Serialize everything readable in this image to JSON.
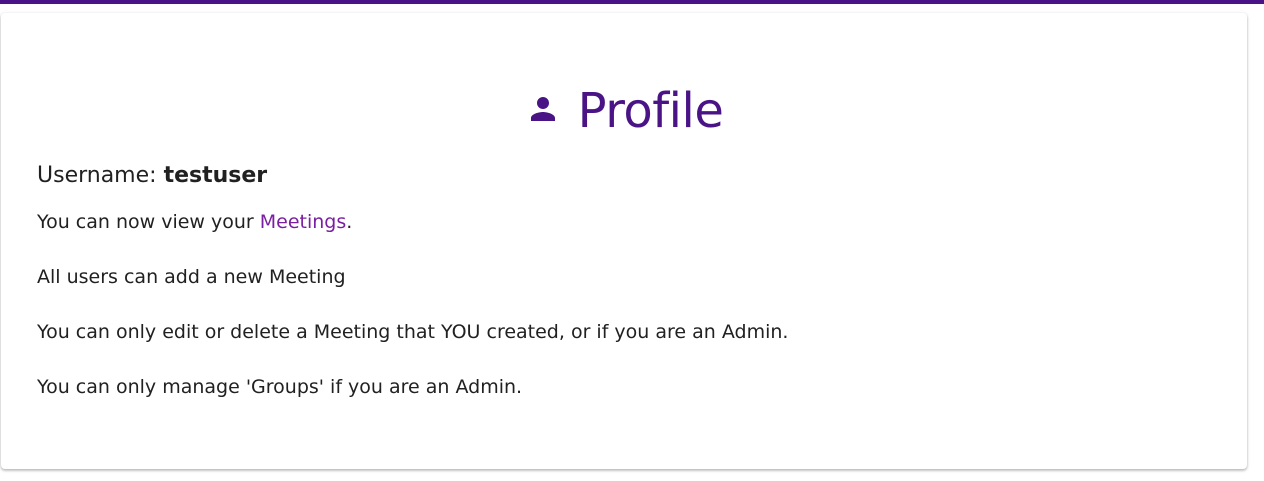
{
  "header": {
    "accent_color": "#4a1486"
  },
  "profile": {
    "icon": "person-icon",
    "title": "Profile",
    "username_label": "Username:",
    "username_value": "testuser",
    "view_prefix": "You can now view your ",
    "meetings_link": "Meetings",
    "view_suffix": ".",
    "info_add": "All users can add a new Meeting",
    "info_edit": "You can only edit or delete a Meeting that YOU created, or if you are an Admin.",
    "info_groups": "You can only manage 'Groups' if you are an Admin."
  }
}
